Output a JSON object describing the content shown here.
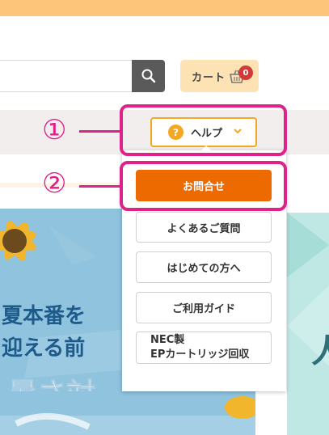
{
  "header": {
    "cart_label": "カート",
    "cart_count": "0",
    "search_placeholder": ""
  },
  "nav": {
    "help_label": "ヘルプ",
    "help_icon": "?"
  },
  "dropdown": {
    "contact_label": "お問合せ",
    "items": [
      {
        "label": "よくあるご質問"
      },
      {
        "label": "はじめての方へ"
      },
      {
        "label": "ご利用ガイド"
      },
      {
        "label_line1": "NEC製",
        "label_line2": "EPカートリッジ回収"
      }
    ]
  },
  "callouts": {
    "one": "①",
    "two": "②"
  },
  "banner": {
    "line1": "夏本番を",
    "line2": "迎える前",
    "line3": "暑さ対策"
  },
  "colors": {
    "accent_orange": "#ed6a00",
    "highlight_pink": "#e0218a",
    "top_bar": "#fcc57a"
  }
}
